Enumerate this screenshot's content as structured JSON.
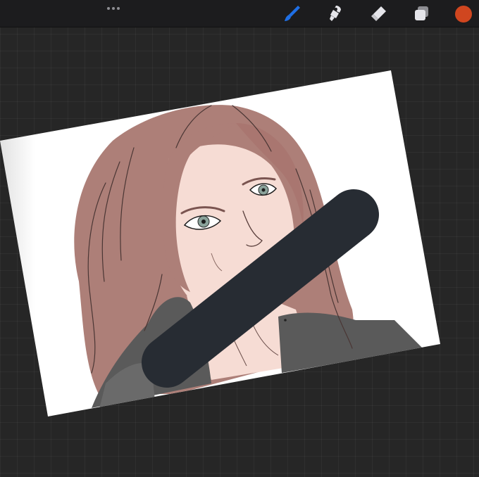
{
  "app": {
    "colors": {
      "background": "#262626",
      "toolbar": "#1c1c1e",
      "icon_default": "#e5e5ea",
      "icon_active": "#1f6fe5",
      "current_color": "#d0461f"
    }
  },
  "toolbar": {
    "menu_icon": "ellipsis-icon",
    "tools": [
      {
        "name": "brush",
        "icon": "brush-icon",
        "active": true
      },
      {
        "name": "smudge",
        "icon": "smudge-icon",
        "active": false
      },
      {
        "name": "eraser",
        "icon": "eraser-icon",
        "active": false
      },
      {
        "name": "layers",
        "icon": "layers-icon",
        "active": false
      }
    ],
    "color_swatch": "#d0461f"
  },
  "canvas": {
    "artwork": "portrait-sketch",
    "stroke_color": "#272c33"
  }
}
